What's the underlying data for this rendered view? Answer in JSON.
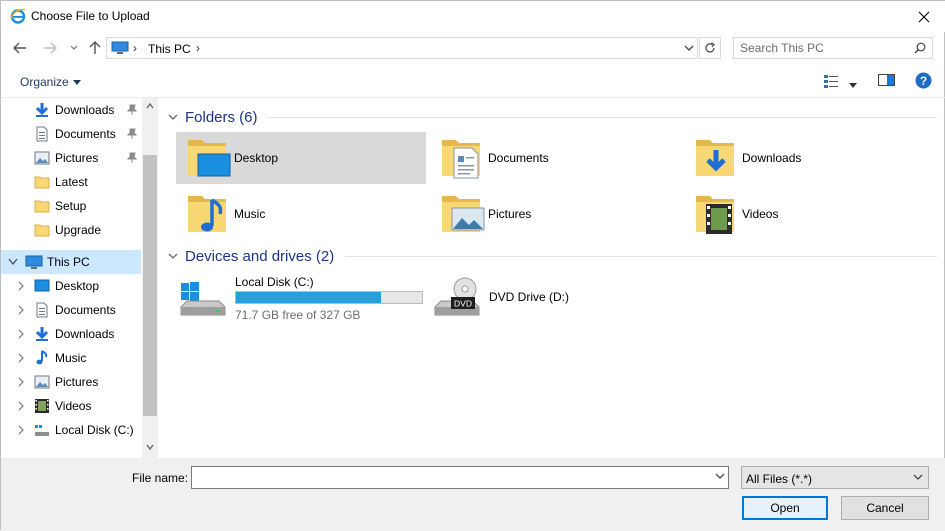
{
  "window": {
    "title": "Choose File to Upload"
  },
  "address": {
    "crumbs": [
      "This PC"
    ],
    "search_placeholder": "Search This PC"
  },
  "commandbar": {
    "organize_label": "Organize"
  },
  "sidebar": {
    "items": [
      {
        "label": "Downloads",
        "icon": "download-arrow-icon",
        "pinned": true
      },
      {
        "label": "Documents",
        "icon": "documents-icon",
        "pinned": true
      },
      {
        "label": "Pictures",
        "icon": "pictures-icon",
        "pinned": true
      },
      {
        "label": "Latest",
        "icon": "folder-icon",
        "pinned": false
      },
      {
        "label": "Setup",
        "icon": "folder-icon",
        "pinned": false
      },
      {
        "label": "Upgrade",
        "icon": "folder-icon",
        "pinned": false
      },
      {
        "label": "This PC",
        "icon": "this-pc-icon",
        "selected": true,
        "expanded": true
      },
      {
        "label": "Desktop",
        "icon": "desktop-icon"
      },
      {
        "label": "Documents",
        "icon": "documents-icon"
      },
      {
        "label": "Downloads",
        "icon": "download-arrow-icon"
      },
      {
        "label": "Music",
        "icon": "music-note-icon"
      },
      {
        "label": "Pictures",
        "icon": "pictures-icon"
      },
      {
        "label": "Videos",
        "icon": "videos-icon"
      },
      {
        "label": "Local Disk (C:)",
        "icon": "local-disk-icon"
      }
    ]
  },
  "content": {
    "folders_header": "Folders (6)",
    "folders": [
      {
        "name": "Desktop",
        "icon": "desktop-folder-icon",
        "selected": true
      },
      {
        "name": "Documents",
        "icon": "documents-folder-icon"
      },
      {
        "name": "Downloads",
        "icon": "downloads-folder-icon"
      },
      {
        "name": "Music",
        "icon": "music-folder-icon"
      },
      {
        "name": "Pictures",
        "icon": "pictures-folder-icon"
      },
      {
        "name": "Videos",
        "icon": "videos-folder-icon"
      }
    ],
    "drives_header": "Devices and drives (2)",
    "drives": [
      {
        "name": "Local Disk (C:)",
        "free_text": "71.7 GB free of 327 GB",
        "used_fraction": 0.78,
        "icon": "windows-drive-icon"
      },
      {
        "name": "DVD Drive (D:)",
        "icon": "dvd-drive-icon",
        "badge": "DVD"
      }
    ]
  },
  "bottom": {
    "filename_label": "File name:",
    "filename_value": "",
    "filetype_value": "All Files (*.*)",
    "open_label": "Open",
    "cancel_label": "Cancel"
  },
  "colors": {
    "accent": "#0078d7",
    "selection": "#cce8ff",
    "header_text": "#1e3287",
    "drive_bar": "#26a0da",
    "folder": "#f8d775"
  }
}
